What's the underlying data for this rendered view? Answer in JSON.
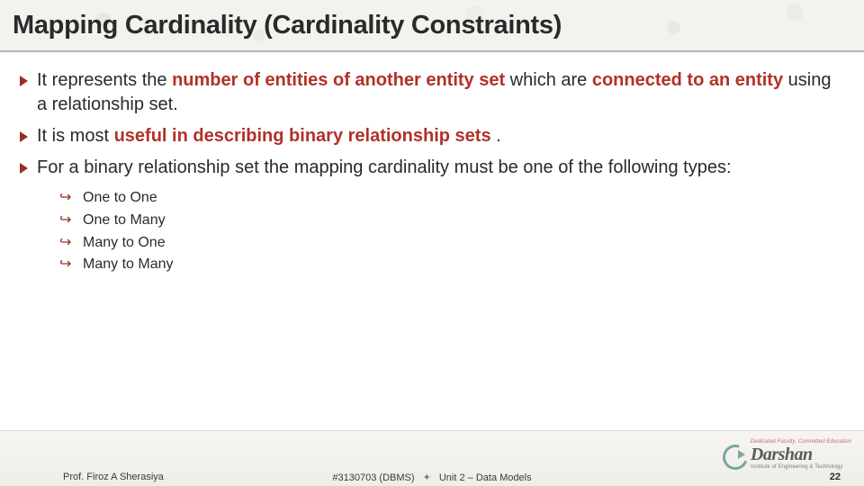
{
  "title": "Mapping Cardinality (Cardinality Constraints)",
  "bullets": {
    "b1": {
      "pre": "It represents the ",
      "hl1": "number of entities of another entity set",
      "mid": " which are ",
      "hl2": "connected to an entity",
      "post": " using a relationship set."
    },
    "b2": {
      "pre": "It is most ",
      "hl1": "useful in describing binary relationship sets",
      "post": " ."
    },
    "b3": {
      "text": "For a binary relationship set the mapping cardinality must be one of the following types:"
    }
  },
  "sub": {
    "s1": "One to One",
    "s2": "One to Many",
    "s3": "Many to One",
    "s4": "Many to Many"
  },
  "footer": {
    "author": "Prof. Firoz A Sherasiya",
    "course": "#3130703 (DBMS)",
    "unit": "Unit 2 – Data Models",
    "page": "22"
  },
  "logo": {
    "tagline": "Dedicated Faculty, Committed Education",
    "name": "Darshan",
    "sub": "Institute of Engineering & Technology"
  }
}
